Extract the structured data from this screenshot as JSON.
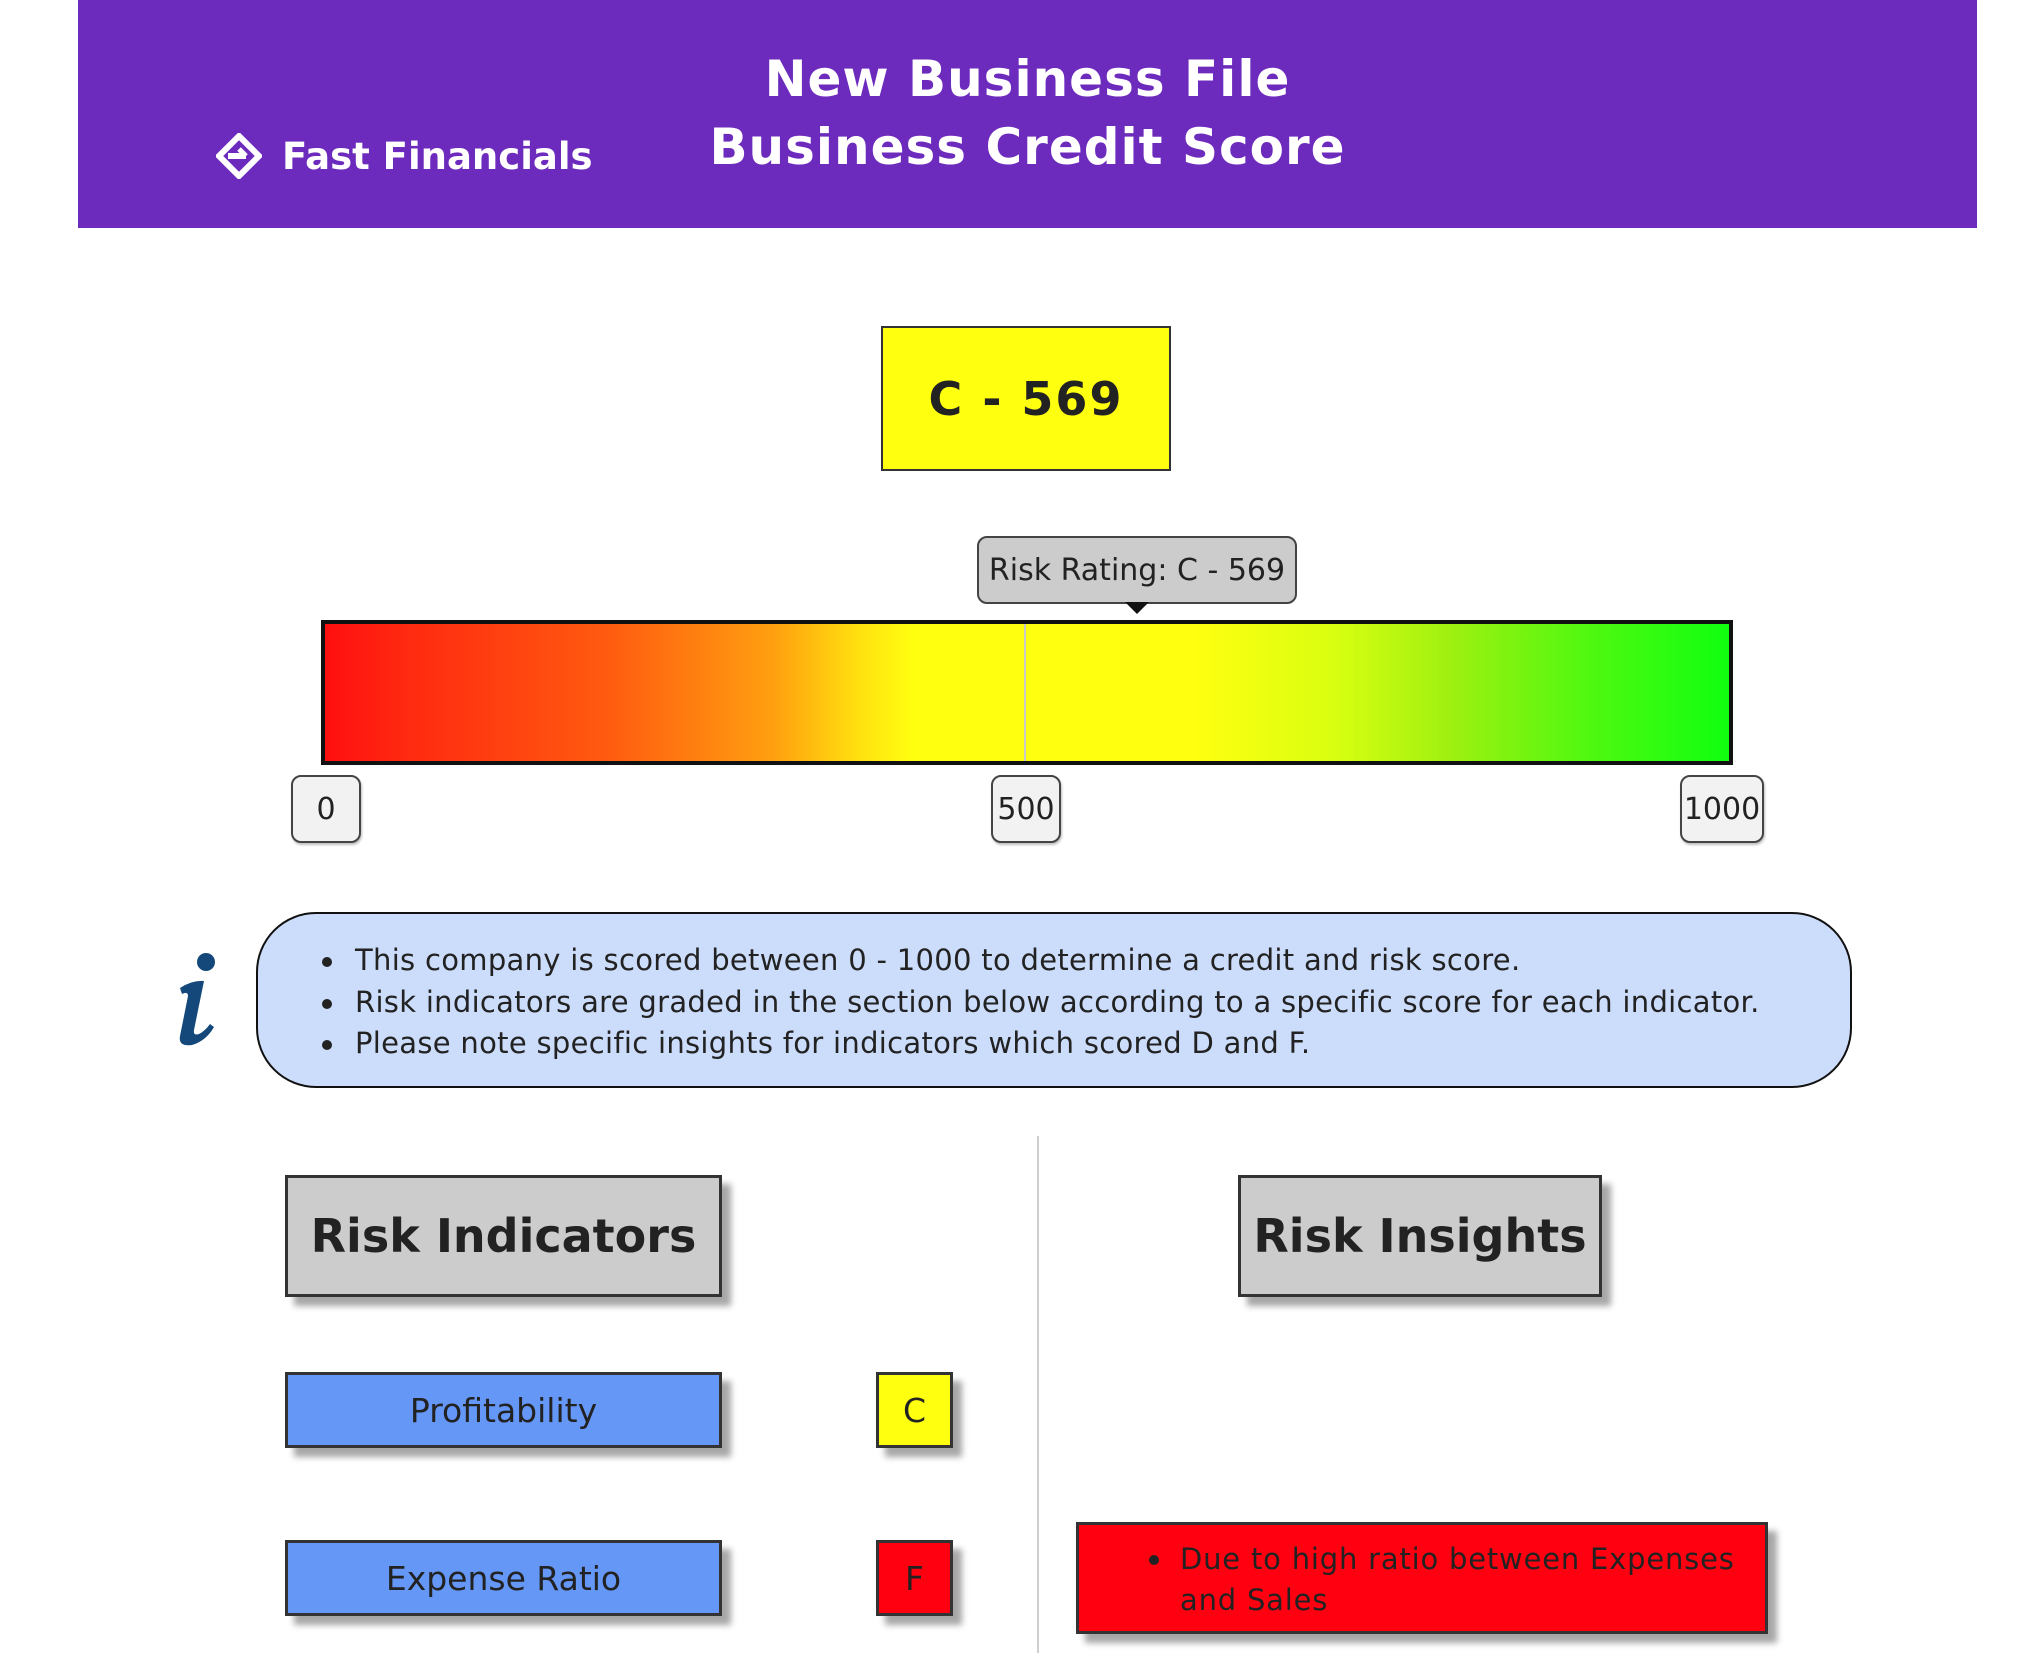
{
  "header": {
    "brand_name": "Fast Financials",
    "title_line1": "New Business File",
    "title_line2": "Business Credit Score",
    "background_color": "#6c2bbd"
  },
  "score": {
    "label": "C - 569",
    "grade": "C",
    "value": 569,
    "box_color": "#ffff10"
  },
  "gauge": {
    "tooltip": "Risk Rating: C - 569",
    "min_label": "0",
    "mid_label": "500",
    "max_label": "1000",
    "min": 0,
    "max": 1000,
    "marker_value": 569,
    "colors": [
      "#ff0f10",
      "#ffff10",
      "#10ff10"
    ]
  },
  "info": {
    "icon": "info-icon",
    "bullets": [
      "This company is scored between 0 - 1000 to determine a credit and risk score.",
      "Risk indicators are graded in the section below according to a specific score for each indicator.",
      "Please note specific insights for indicators which scored D and F."
    ]
  },
  "risk_indicators": {
    "heading": "Risk Indicators",
    "items": [
      {
        "label": "Profitability",
        "grade": "C",
        "grade_color": "#ffff10"
      },
      {
        "label": "Expense Ratio",
        "grade": "F",
        "grade_color": "#ff0010"
      }
    ]
  },
  "risk_insights": {
    "heading": "Risk Insights",
    "items": [
      {
        "text": "Due to high ratio between Expenses and Sales",
        "color": "#ff0010"
      }
    ]
  }
}
